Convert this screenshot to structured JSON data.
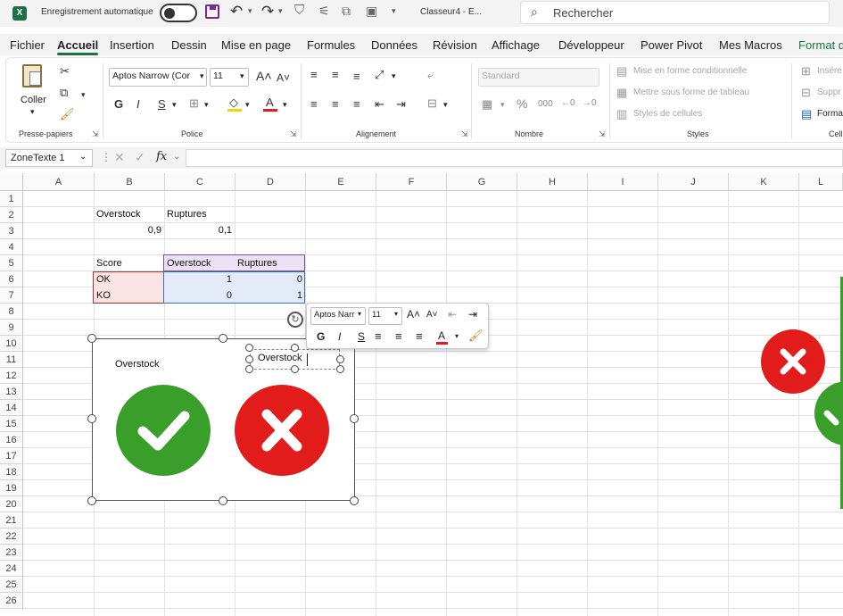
{
  "titlebar": {
    "autosave_label": "Enregistrement automatique",
    "doc_title": "Classeur4 - E...",
    "search_placeholder": "Rechercher"
  },
  "menu": {
    "tabs": [
      "Fichier",
      "Accueil",
      "Insertion",
      "Dessin",
      "Mise en page",
      "Formules",
      "Données",
      "Révision",
      "Affichage",
      "Développeur",
      "Power Pivot",
      "Mes Macros",
      "Format d"
    ],
    "active": "Accueil"
  },
  "ribbon": {
    "clipboard": {
      "paste_label": "Coller",
      "group_label": "Presse-papiers"
    },
    "font": {
      "name": "Aptos Narrow (Cor",
      "size": "11",
      "group_label": "Police",
      "bold": "G",
      "italic": "I",
      "underline": "S"
    },
    "alignment": {
      "group_label": "Alignement"
    },
    "number": {
      "format": "Standard",
      "group_label": "Nombre",
      "percent": "%"
    },
    "styles": {
      "conditional": "Mise en forme conditionnelle",
      "as_table": "Mettre sous forme de tableau",
      "cell_styles": "Styles de cellules",
      "group_label": "Styles"
    },
    "cells": {
      "insert": "Insére",
      "delete": "Suppr",
      "format": "Forma",
      "group_label": "Cell"
    }
  },
  "formula_bar": {
    "name_box": "ZoneTexte 1",
    "fx": "fx",
    "value": ""
  },
  "grid": {
    "columns": [
      "A",
      "B",
      "C",
      "D",
      "E",
      "F",
      "G",
      "H",
      "I",
      "J",
      "K",
      "L"
    ],
    "rows": [
      "1",
      "2",
      "3",
      "4",
      "5",
      "6",
      "7",
      "8",
      "9",
      "10",
      "11",
      "12",
      "13",
      "14",
      "15",
      "16",
      "17",
      "18",
      "19",
      "20",
      "21",
      "22",
      "23",
      "24",
      "25",
      "26"
    ],
    "cells": {
      "B2": "Overstock",
      "C2": "Ruptures",
      "B3": "0,9",
      "C3": "0,1",
      "B5": "Score",
      "C5": "Overstock",
      "D5": "Ruptures",
      "B6": "OK",
      "C6": "1",
      "D6": "0",
      "B7": "KO",
      "C7": "0",
      "D7": "1"
    }
  },
  "shape": {
    "label": "Overstock",
    "textbox_value": "Overstock",
    "check_color": "#3a9e2a",
    "cross_color": "#e21b1b"
  },
  "mini_toolbar": {
    "font": "Aptos Narr",
    "size": "11",
    "bold": "G",
    "italic": "I",
    "underline": "S",
    "font_color_letter": "A"
  }
}
